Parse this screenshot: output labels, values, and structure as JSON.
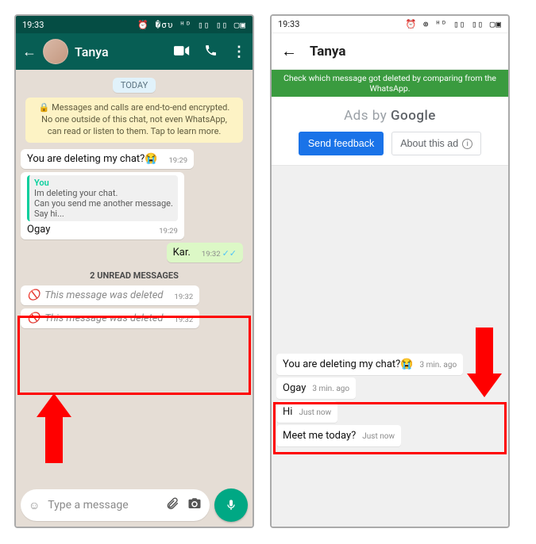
{
  "left": {
    "statusbar": {
      "time": "19:33",
      "icons": "⏰ �συ ᴴᴰ ▯▯ ▯▯ ▢▣"
    },
    "header": {
      "name": "Tanya"
    },
    "date_pill": "TODAY",
    "enc_notice": "🔒 Messages and calls are end-to-end encrypted. No one outside of this chat, not even WhatsApp, can read or listen to them. Tap to learn more.",
    "messages": {
      "m1": {
        "text": "You are deleting my chat?😭",
        "time": "19:29"
      },
      "m2": {
        "quote_name": "You",
        "quote_text": "Im deleting your chat.\nCan you send me another message.\nSay hi...",
        "text": "Ogay",
        "time": "19:29"
      },
      "m3_out": {
        "text": "Kar.",
        "time": "19:32"
      },
      "unread_label": "2 UNREAD MESSAGES",
      "d1": {
        "text": "This message was deleted",
        "time": "19:32"
      },
      "d2": {
        "text": "This message was deleted",
        "time": "19:32"
      }
    },
    "input_placeholder": "Type a message"
  },
  "right": {
    "statusbar": {
      "time": "19:33",
      "icons": "⏰ ⊚ ᴴᴰ ▯▯ ▯▯ ▢▣"
    },
    "header": {
      "name": "Tanya"
    },
    "banner": "Check which message got deleted by comparing from the WhatsApp.",
    "ads_by": "Ads by",
    "ads_brand": "Google",
    "btn_feedback": "Send feedback",
    "btn_about": "About this ad",
    "messages": {
      "r1": {
        "text": "You are deleting my chat?😭",
        "time": "3 min. ago"
      },
      "r2": {
        "text": "Ogay",
        "time": "3 min. ago"
      },
      "r3": {
        "text": "Hi",
        "time": "Just now"
      },
      "r4": {
        "text": "Meet me today?",
        "time": "Just now"
      }
    }
  }
}
